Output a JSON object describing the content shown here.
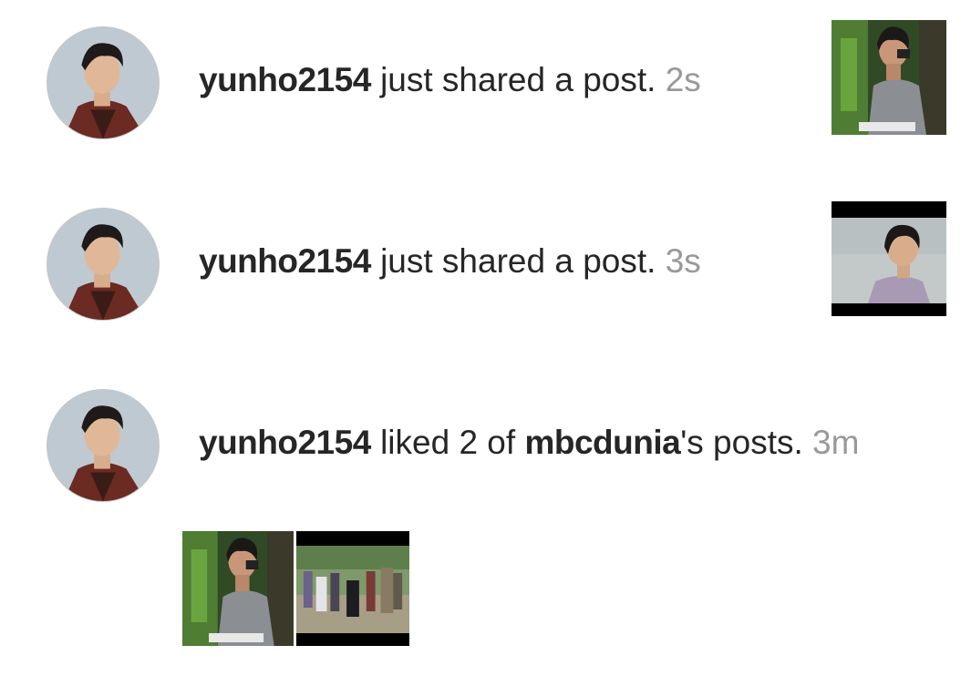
{
  "notifications": [
    {
      "username": "yunho2154",
      "action": " just shared a post.",
      "time": "2s",
      "thumbnails": [
        "jungle-poster"
      ]
    },
    {
      "username": "yunho2154",
      "action": " just shared a post.",
      "time": "3s",
      "thumbnails": [
        "video-still-portrait"
      ]
    },
    {
      "username": "yunho2154",
      "action_pre": " liked 2 of ",
      "target_user": "mbcdunia",
      "action_post": "'s posts.",
      "time": "3m",
      "thumbnails": [
        "jungle-poster",
        "group-video-still"
      ]
    }
  ],
  "colors": {
    "text": "#262626",
    "timestamp": "#999999",
    "background": "#ffffff"
  }
}
